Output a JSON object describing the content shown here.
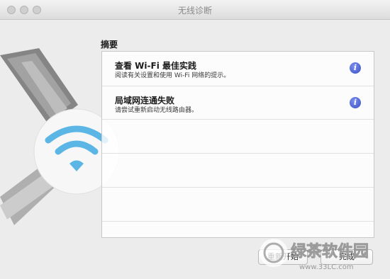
{
  "window": {
    "title": "无线诊断"
  },
  "summary": {
    "label": "摘要",
    "items": [
      {
        "title": "查看 Wi-Fi 最佳实践",
        "subtitle": "阅读有关设置和使用 Wi-Fi 网络的提示。",
        "icon": "info-icon"
      },
      {
        "title": "局域网连通失败",
        "subtitle": "请尝试重新启动无线路由器。",
        "icon": "info-icon"
      }
    ]
  },
  "buttons": {
    "restart": "重新开始",
    "done": "完成"
  },
  "watermark": {
    "name": "绿茶软件园",
    "url": "www.33LC.com"
  },
  "colors": {
    "info_icon": "#3a4fc4",
    "wifi": "#5bb6e6"
  }
}
